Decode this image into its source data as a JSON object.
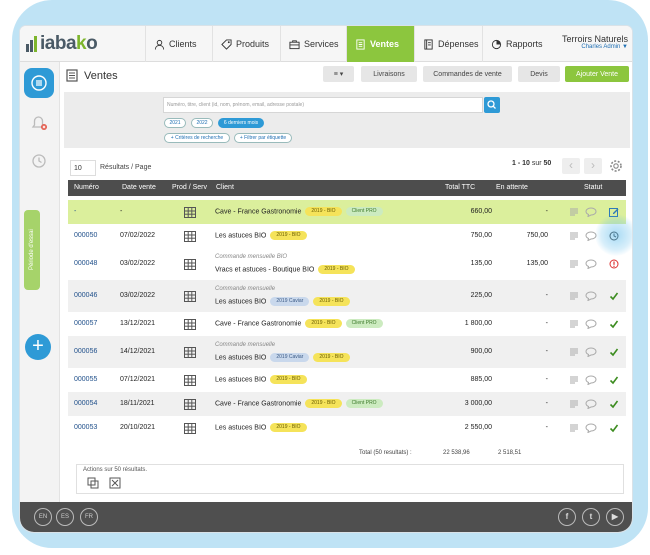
{
  "app": {
    "logo": "iabako",
    "logo_k": "k"
  },
  "nav": {
    "items": [
      {
        "label": "Clients",
        "icon": "user-icon"
      },
      {
        "label": "Produits",
        "icon": "tag-icon"
      },
      {
        "label": "Services",
        "icon": "briefcase-icon"
      },
      {
        "label": "Ventes",
        "icon": "register-icon"
      },
      {
        "label": "Dépenses",
        "icon": "ledger-icon"
      },
      {
        "label": "Rapports",
        "icon": "pie-chart-icon"
      }
    ],
    "active": "Ventes",
    "user_name": "Terroirs Naturels",
    "user_sub": "Charles Admin ▼"
  },
  "rail": {
    "tab_label": "Période d'essai"
  },
  "header": {
    "title": "Ventes",
    "buttons": {
      "menu": "≡ ▾",
      "livraisons": "Livraisons",
      "commandes": "Commandes de vente",
      "devis": "Devis",
      "ajouter": "Ajouter Vente"
    }
  },
  "filter": {
    "search_placeholder": "Numéro, titre, client (id, nom, prénom, email, adresse postale)",
    "chips_years": [
      "2021",
      "2022"
    ],
    "chip_active": "6 derniers mois",
    "chip_criteria": "+ Critères de recherche",
    "chip_label": "+ Filtrer par étiquette"
  },
  "pagination": {
    "per_page_value": "10",
    "per_page_label": "Résultats / Page",
    "range_prefix": "1 - 10",
    "range_sep": " sur ",
    "range_total": "50",
    "prev": "‹",
    "next": "›"
  },
  "table": {
    "headers": {
      "numero": "Numéro",
      "date": "Date vente",
      "prod": "Prod / Serv",
      "client": "Client",
      "total": "Total TTC",
      "attente": "En attente",
      "statut": "Statut"
    },
    "rows": [
      {
        "num": "-",
        "date": "-",
        "client": "Cave - France Gastronomie",
        "sub": "",
        "tags": [
          {
            "t": "2019 - BIO",
            "c": "y"
          },
          {
            "t": "Client PRO",
            "c": "g"
          }
        ],
        "total": "660,00",
        "attente": "-",
        "status": "edit-icon"
      },
      {
        "num": "000050",
        "date": "07/02/2022",
        "client": "Les astuces BIO",
        "sub": "",
        "tags": [
          {
            "t": "2019 - BIO",
            "c": "y"
          }
        ],
        "total": "750,00",
        "attente": "750,00",
        "status": "clock-icon"
      },
      {
        "num": "000048",
        "date": "03/02/2022",
        "client": "Vracs et astuces - Boutique BIO",
        "sub": "Commande mensuelle BIO",
        "tags": [
          {
            "t": "2019 - BIO",
            "c": "y"
          }
        ],
        "total": "135,00",
        "attente": "135,00",
        "status": "alert-icon"
      },
      {
        "num": "000046",
        "date": "03/02/2022",
        "client": "Les astuces BIO",
        "sub": "Commande mensuelle",
        "tags": [
          {
            "t": "2019 Caviar",
            "c": "b"
          },
          {
            "t": "2019 - BIO",
            "c": "y"
          }
        ],
        "total": "225,00",
        "attente": "-",
        "status": "check-icon"
      },
      {
        "num": "000057",
        "date": "13/12/2021",
        "client": "Cave - France Gastronomie",
        "sub": "",
        "tags": [
          {
            "t": "2019 - BIO",
            "c": "y"
          },
          {
            "t": "Client PRO",
            "c": "g"
          }
        ],
        "total": "1 800,00",
        "attente": "-",
        "status": "check-icon"
      },
      {
        "num": "000056",
        "date": "14/12/2021",
        "client": "Les astuces BIO",
        "sub": "Commande mensuelle",
        "tags": [
          {
            "t": "2019 Caviar",
            "c": "b"
          },
          {
            "t": "2019 - BIO",
            "c": "y"
          }
        ],
        "total": "900,00",
        "attente": "-",
        "status": "check-icon"
      },
      {
        "num": "000055",
        "date": "07/12/2021",
        "client": "Les astuces BIO",
        "sub": "",
        "tags": [
          {
            "t": "2019 - BIO",
            "c": "y"
          }
        ],
        "total": "885,00",
        "attente": "-",
        "status": "check-icon"
      },
      {
        "num": "000054",
        "date": "18/11/2021",
        "client": "Cave - France Gastronomie",
        "sub": "",
        "tags": [
          {
            "t": "2019 - BIO",
            "c": "y"
          },
          {
            "t": "Client PRO",
            "c": "g"
          }
        ],
        "total": "3 000,00",
        "attente": "-",
        "status": "check-icon"
      },
      {
        "num": "000053",
        "date": "20/10/2021",
        "client": "Les astuces BIO",
        "sub": "",
        "tags": [
          {
            "t": "2019 - BIO",
            "c": "y"
          }
        ],
        "total": "2 550,00",
        "attente": "-",
        "status": "check-icon"
      }
    ],
    "total_label": "Total (50 resultats) :",
    "total_ttc": "22 538,96",
    "total_attente": "2 518,51"
  },
  "actions": {
    "label": "Actions sur 50 résultats."
  },
  "footer": {
    "langs": [
      "EN",
      "ES",
      "FR"
    ],
    "social": [
      "f",
      "t",
      "▶"
    ]
  },
  "colors": {
    "accent": "#8cc63e",
    "blue": "#2e9ad6",
    "header": "#4d4d4d"
  }
}
